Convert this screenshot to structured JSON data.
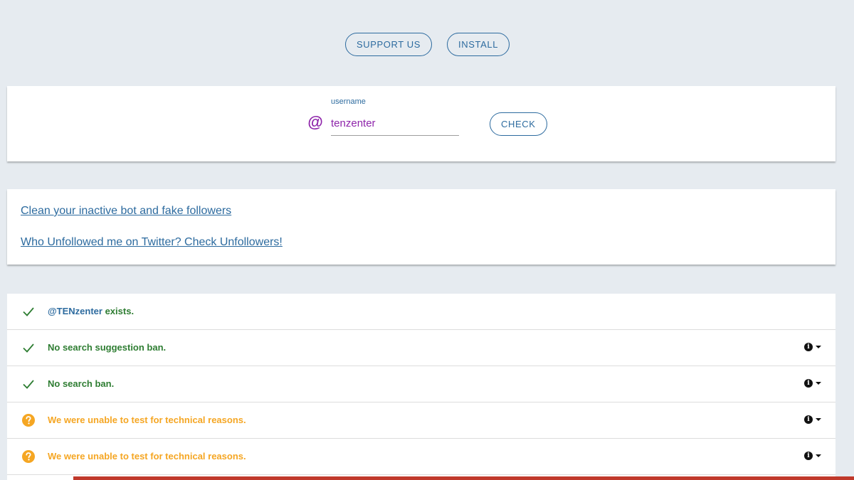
{
  "top_buttons": {
    "support_label": "SUPPORT US",
    "install_label": "INSTALL"
  },
  "search": {
    "at_symbol": "@",
    "field_label": "username",
    "username_value": "tenzenter",
    "check_label": "CHECK"
  },
  "links": [
    {
      "text": "Clean your inactive bot and fake followers"
    },
    {
      "text": "Who Unfollowed me on Twitter? Check Unfollowers!"
    }
  ],
  "results": [
    {
      "status": "ok",
      "icon": "check-icon",
      "handle": "@TENzenter",
      "text": " exists.",
      "has_info": false
    },
    {
      "status": "ok",
      "icon": "check-icon",
      "handle": "",
      "text": "No search suggestion ban.",
      "has_info": true
    },
    {
      "status": "ok",
      "icon": "check-icon",
      "handle": "",
      "text": "No search ban.",
      "has_info": true
    },
    {
      "status": "warn",
      "icon": "question-circle-icon",
      "handle": "",
      "text": "We were unable to test for technical reasons.",
      "has_info": true
    },
    {
      "status": "warn",
      "icon": "question-circle-icon",
      "handle": "",
      "text": "We were unable to test for technical reasons.",
      "has_info": true
    }
  ],
  "info_glyph": "i",
  "colors": {
    "accent": "#2d6b9f",
    "username": "#8e24aa",
    "ok": "#2e7d32",
    "warn": "#f5a623",
    "bottom_bar": "#c0392b"
  }
}
